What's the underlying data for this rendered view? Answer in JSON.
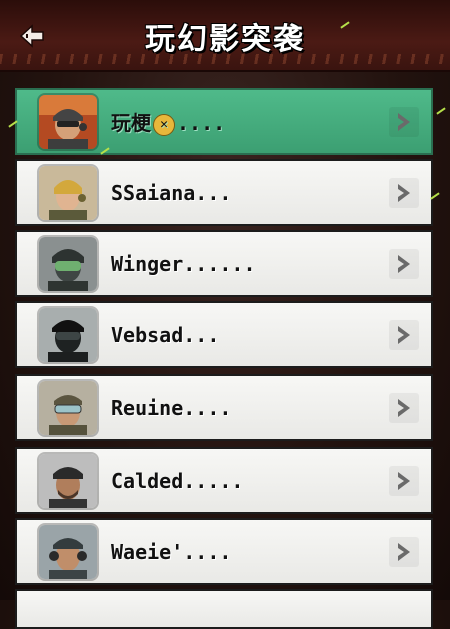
{
  "header": {
    "title": "玩幻影突袭",
    "back_icon": "back-arrow-icon"
  },
  "colors": {
    "selected_row": "#4fba8a",
    "row": "#f0f0ee",
    "header": "#4b1a14"
  },
  "list": {
    "selected_index": 0,
    "items": [
      {
        "name_prefix": "玩梗",
        "badge": "✕",
        "name_suffix": "....",
        "avatar": "orange-helmet-soldier-avatar"
      },
      {
        "name_prefix": "SSaiana...",
        "badge": "",
        "name_suffix": "",
        "avatar": "blonde-soldier-avatar"
      },
      {
        "name_prefix": "Winger......",
        "badge": "",
        "name_suffix": "",
        "avatar": "green-visor-soldier-avatar"
      },
      {
        "name_prefix": "Vebsad...",
        "badge": "",
        "name_suffix": "",
        "avatar": "masked-soldier-avatar"
      },
      {
        "name_prefix": "Reuine....",
        "badge": "",
        "name_suffix": "",
        "avatar": "goggles-soldier-avatar"
      },
      {
        "name_prefix": "Calded.....",
        "badge": "",
        "name_suffix": "",
        "avatar": "bearded-soldier-avatar"
      },
      {
        "name_prefix": "Waeie'....",
        "badge": "",
        "name_suffix": "",
        "avatar": "headset-soldier-avatar"
      }
    ]
  }
}
